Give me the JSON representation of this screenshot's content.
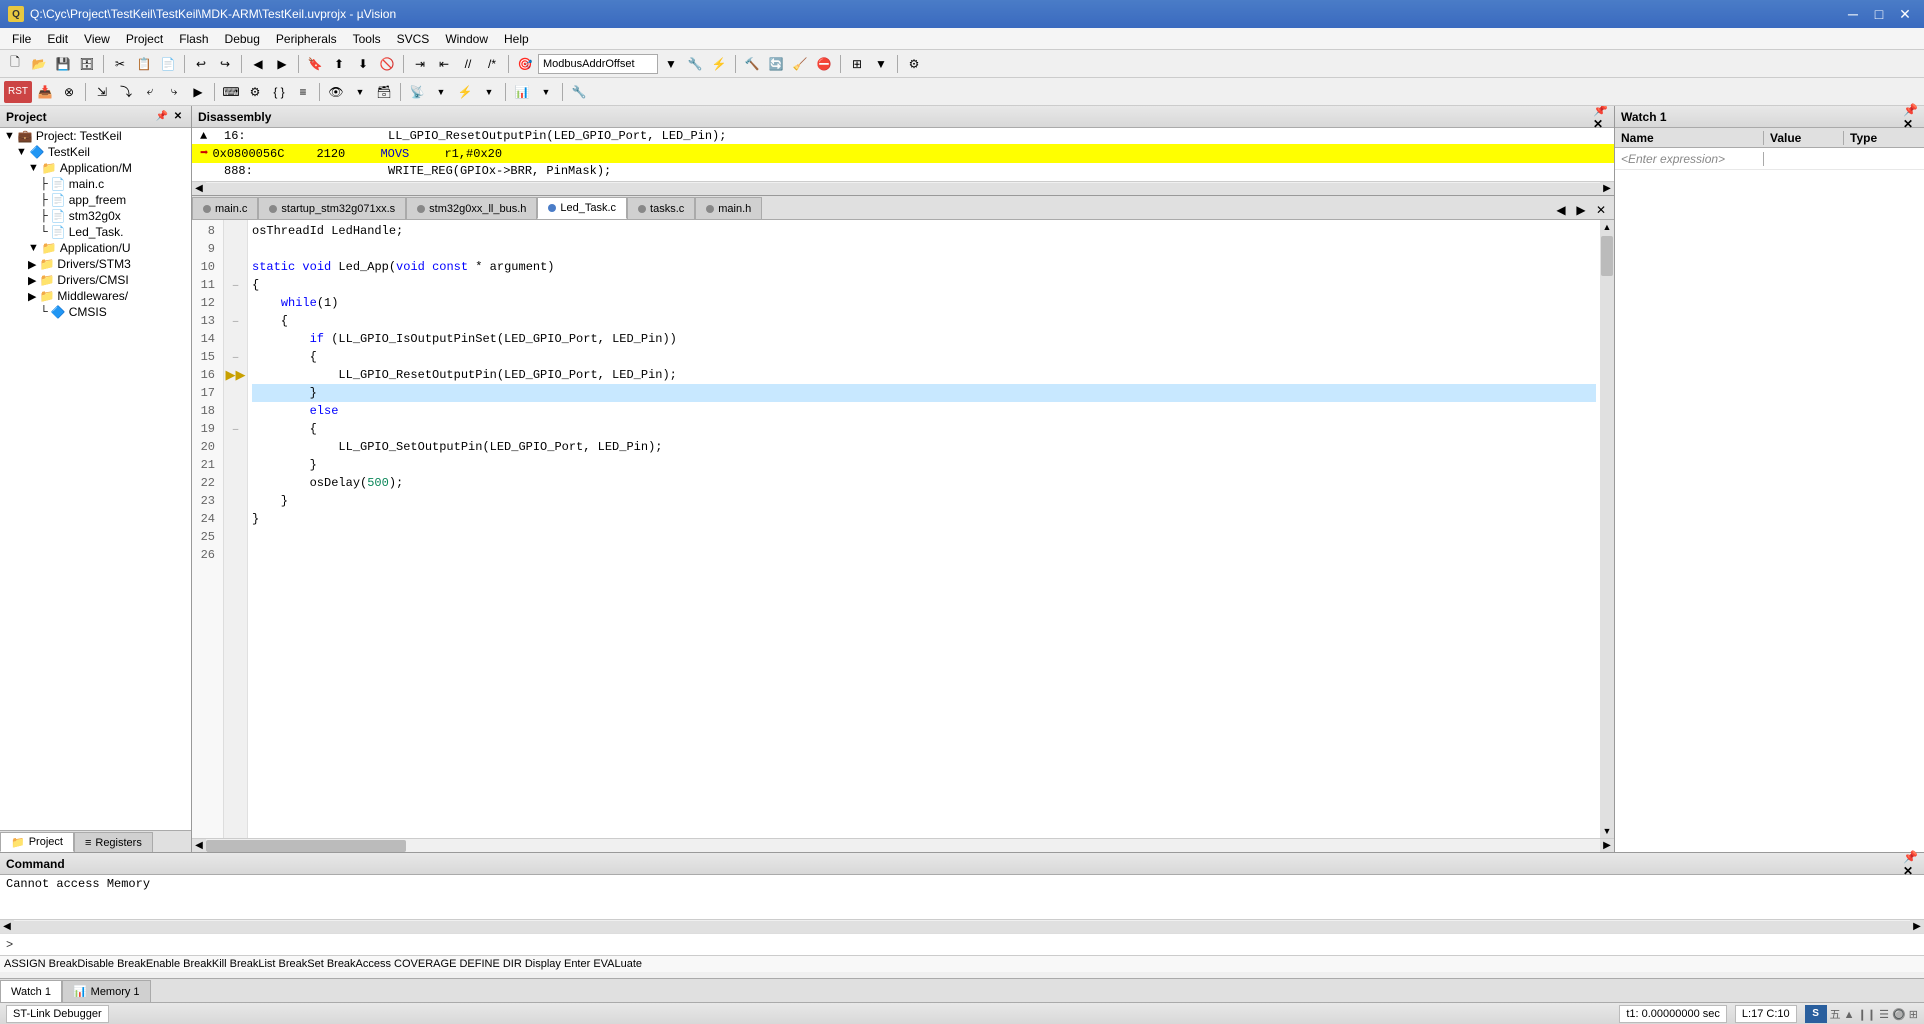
{
  "titlebar": {
    "title": "Q:\\Cyc\\Project\\TestKeil\\TestKeil\\MDK-ARM\\TestKeil.uvprojx - µVision",
    "icon": "Q"
  },
  "menubar": {
    "items": [
      "File",
      "Edit",
      "View",
      "Project",
      "Flash",
      "Debug",
      "Peripherals",
      "Tools",
      "SVCS",
      "Window",
      "Help"
    ]
  },
  "toolbar1": {
    "dropdown_value": "ModbusAddrOffset"
  },
  "project_panel": {
    "title": "Project",
    "root": "Project: TestKeil",
    "items": [
      {
        "label": "TestKeil",
        "indent": 1,
        "type": "folder"
      },
      {
        "label": "Application/M",
        "indent": 2,
        "type": "folder"
      },
      {
        "label": "main.c",
        "indent": 3,
        "type": "file"
      },
      {
        "label": "app_freem",
        "indent": 3,
        "type": "file"
      },
      {
        "label": "stm32g0x",
        "indent": 3,
        "type": "file"
      },
      {
        "label": "Led_Task.",
        "indent": 3,
        "type": "file"
      },
      {
        "label": "Application/U",
        "indent": 2,
        "type": "folder"
      },
      {
        "label": "Drivers/STM3",
        "indent": 2,
        "type": "folder"
      },
      {
        "label": "Drivers/CMSI",
        "indent": 2,
        "type": "folder"
      },
      {
        "label": "Middlewares/",
        "indent": 2,
        "type": "folder"
      },
      {
        "label": "CMSIS",
        "indent": 3,
        "type": "component"
      }
    ]
  },
  "project_tabs": [
    {
      "label": "Project",
      "icon": "📁",
      "active": true
    },
    {
      "label": "Registers",
      "icon": "≡",
      "active": false
    }
  ],
  "disassembly": {
    "title": "Disassembly",
    "lines": [
      {
        "num": "16:",
        "addr": "",
        "bytes": "",
        "mnemonic": "LL_GPIO_ResetOutputPin(LED_GPIO_Port, LED_Pin);",
        "highlighted": false,
        "arrow": false
      },
      {
        "num": "",
        "addr": "0x0800056C",
        "bytes": "2120",
        "mnemonic": "MOVS",
        "operands": "r1,#0x20",
        "highlighted": true,
        "arrow": true
      },
      {
        "num": "888:",
        "addr": "",
        "bytes": "",
        "mnemonic": "WRITE_REG(GPIOx->BRR, PinMask);",
        "highlighted": false,
        "arrow": false
      }
    ]
  },
  "editor_tabs": [
    {
      "label": "main.c",
      "active": false,
      "color": "#ddd"
    },
    {
      "label": "startup_stm32g071xx.s",
      "active": false,
      "color": "#ddd"
    },
    {
      "label": "stm32g0xx_ll_bus.h",
      "active": false,
      "color": "#ddd"
    },
    {
      "label": "Led_Task.c",
      "active": true,
      "color": "#4a7cc7"
    },
    {
      "label": "tasks.c",
      "active": false,
      "color": "#ddd"
    },
    {
      "label": "main.h",
      "active": false,
      "color": "#ddd"
    }
  ],
  "code_lines": [
    {
      "num": 8,
      "code": "osThreadId LedHandle;",
      "indent": 0
    },
    {
      "num": 9,
      "code": "",
      "indent": 0
    },
    {
      "num": 10,
      "code": "static void Led_App(void const * argument)",
      "indent": 0
    },
    {
      "num": 11,
      "code": "{",
      "indent": 0,
      "fold": true
    },
    {
      "num": 12,
      "code": "    while(1)",
      "indent": 1
    },
    {
      "num": 13,
      "code": "    {",
      "indent": 1,
      "fold": true
    },
    {
      "num": 14,
      "code": "        if (LL_GPIO_IsOutputPinSet(LED_GPIO_Port, LED_Pin))",
      "indent": 2
    },
    {
      "num": 15,
      "code": "        {",
      "indent": 2,
      "fold": true
    },
    {
      "num": 16,
      "code": "            LL_GPIO_ResetOutputPin(LED_GPIO_Port, LED_Pin);",
      "indent": 3,
      "arrow": true
    },
    {
      "num": 17,
      "code": "        }",
      "indent": 2,
      "current": true
    },
    {
      "num": 18,
      "code": "        else",
      "indent": 2
    },
    {
      "num": 19,
      "code": "        {",
      "indent": 2,
      "fold": true
    },
    {
      "num": 20,
      "code": "            LL_GPIO_SetOutputPin(LED_GPIO_Port, LED_Pin);",
      "indent": 3
    },
    {
      "num": 21,
      "code": "        }",
      "indent": 2
    },
    {
      "num": 22,
      "code": "        osDelay(500);",
      "indent": 2
    },
    {
      "num": 23,
      "code": "    }",
      "indent": 1
    },
    {
      "num": 24,
      "code": "}",
      "indent": 0
    },
    {
      "num": 25,
      "code": "",
      "indent": 0
    },
    {
      "num": 26,
      "code": "",
      "indent": 0
    }
  ],
  "watch_panel": {
    "title": "Watch 1",
    "columns": [
      "Name",
      "Value",
      "Type"
    ],
    "expression_placeholder": "<Enter expression>"
  },
  "command_panel": {
    "title": "Command",
    "output": "Cannot access Memory",
    "prompt": ">",
    "keywords": "ASSIGN  BreakDisable  BreakEnable  BreakKill  BreakList  BreakSet  BreakAccess  COVERAGE  DEFINE  DIR  Display  Enter  EVALuate"
  },
  "bottom_tabs": [
    {
      "label": "Watch 1",
      "active": true
    },
    {
      "label": "Memory 1",
      "active": false
    }
  ],
  "statusbar": {
    "debugger": "ST-Link Debugger",
    "time": "t1: 0.00000000 sec",
    "position": "L:17 C:10"
  },
  "icons": {
    "folder_open": "📂",
    "folder_closed": "📁",
    "file": "📄",
    "component": "🔷",
    "arrow_right": "▶",
    "arrow_down": "▼",
    "close": "✕",
    "minimize": "─",
    "maximize": "□",
    "pin": "📌",
    "chevron_right": "›",
    "chevron_left": "‹",
    "chevron_up": "▲",
    "chevron_down": "▼"
  }
}
